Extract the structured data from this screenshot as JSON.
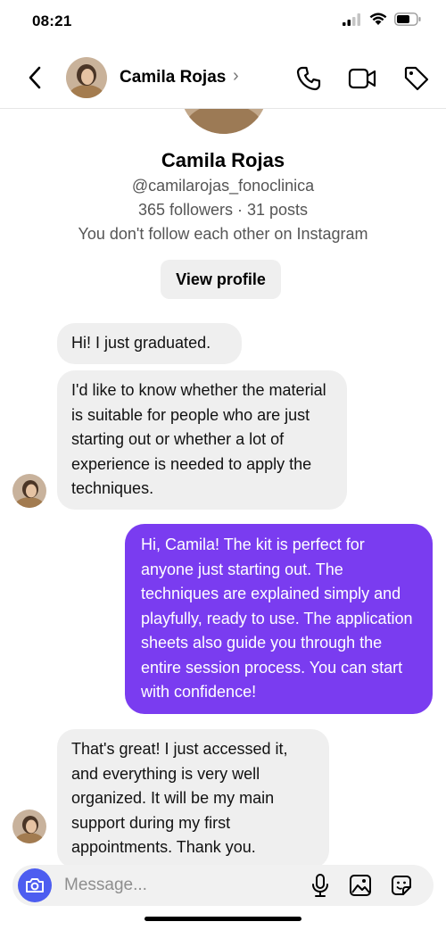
{
  "status_bar": {
    "time": "08:21",
    "icons": [
      "cellular-signal-icon",
      "wifi-icon",
      "battery-icon"
    ]
  },
  "header": {
    "contact_name": "Camila Rojas",
    "chevron": "›",
    "actions": [
      "phone-icon",
      "video-call-icon",
      "tag-icon"
    ]
  },
  "profile": {
    "name": "Camila Rojas",
    "username": "@camilarojas_fonoclinica",
    "stats": "365 followers · 31 posts",
    "relationship": "You don't follow each other on Instagram",
    "view_profile_label": "View profile"
  },
  "messages": [
    {
      "sender": "them",
      "text": "Hi! I just graduated."
    },
    {
      "sender": "them",
      "text": "I'd like to know whether the material is suitable for people who are just starting out or whether a lot of experience is needed to apply the techniques."
    },
    {
      "sender": "me",
      "text": "Hi, Camila! The kit is perfect for anyone just starting out. The techniques are explained simply and playfully, ready to use. The application sheets also guide you through the entire session process. You can start with confidence!"
    },
    {
      "sender": "them",
      "text": "That's great! I just accessed it, and everything is very well organized. It will be my main support during my first appointments. Thank you."
    }
  ],
  "composer": {
    "placeholder": "Message...",
    "icons": [
      "camera-icon",
      "microphone-icon",
      "gallery-icon",
      "sticker-icon"
    ]
  },
  "colors": {
    "outgoing_bubble": "#7a3cf0",
    "incoming_bubble": "#efefef",
    "camera_button": "#4d5df0"
  }
}
